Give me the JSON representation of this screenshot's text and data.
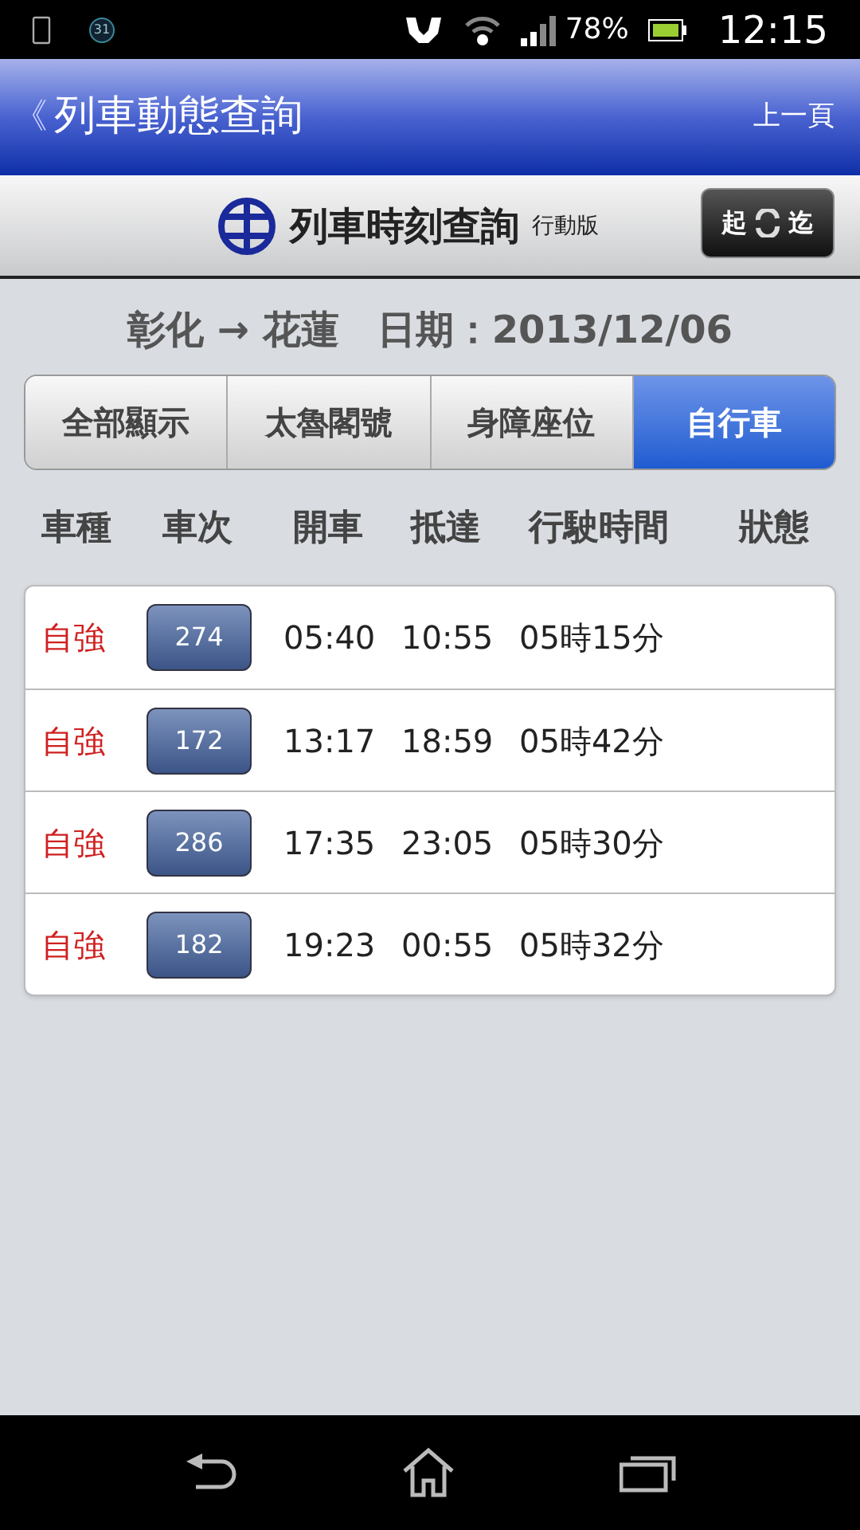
{
  "status_bar": {
    "notification": "31",
    "battery": "78%",
    "time": "12:15"
  },
  "header": {
    "back_label": "《",
    "title": "列車動態查詢",
    "right_button": "上一頁"
  },
  "app_bar": {
    "title": "列車時刻查詢",
    "subtitle": "行動版",
    "swap_button": {
      "from": "起",
      "to": "迄"
    }
  },
  "route": {
    "text": "彰化 → 花蓮",
    "date_label": "日期：2013/12/06"
  },
  "tabs": [
    {
      "label": "全部顯示",
      "selected": false
    },
    {
      "label": "太魯閣號",
      "selected": false
    },
    {
      "label": "身障座位",
      "selected": false
    },
    {
      "label": "自行車",
      "selected": true
    }
  ],
  "table": {
    "columns": [
      "車種",
      "車次",
      "開車",
      "抵達",
      "行駛時間",
      "狀態"
    ],
    "rows": [
      {
        "type": "自強",
        "train": "274",
        "depart": "05:40",
        "arrive": "10:55",
        "duration": "05時15分"
      },
      {
        "type": "自強",
        "train": "172",
        "depart": "13:17",
        "arrive": "18:59",
        "duration": "05時42分"
      },
      {
        "type": "自強",
        "train": "286",
        "depart": "17:35",
        "arrive": "23:05",
        "duration": "05時30分"
      },
      {
        "type": "自強",
        "train": "182",
        "depart": "19:23",
        "arrive": "00:55",
        "duration": "05時32分"
      }
    ]
  }
}
